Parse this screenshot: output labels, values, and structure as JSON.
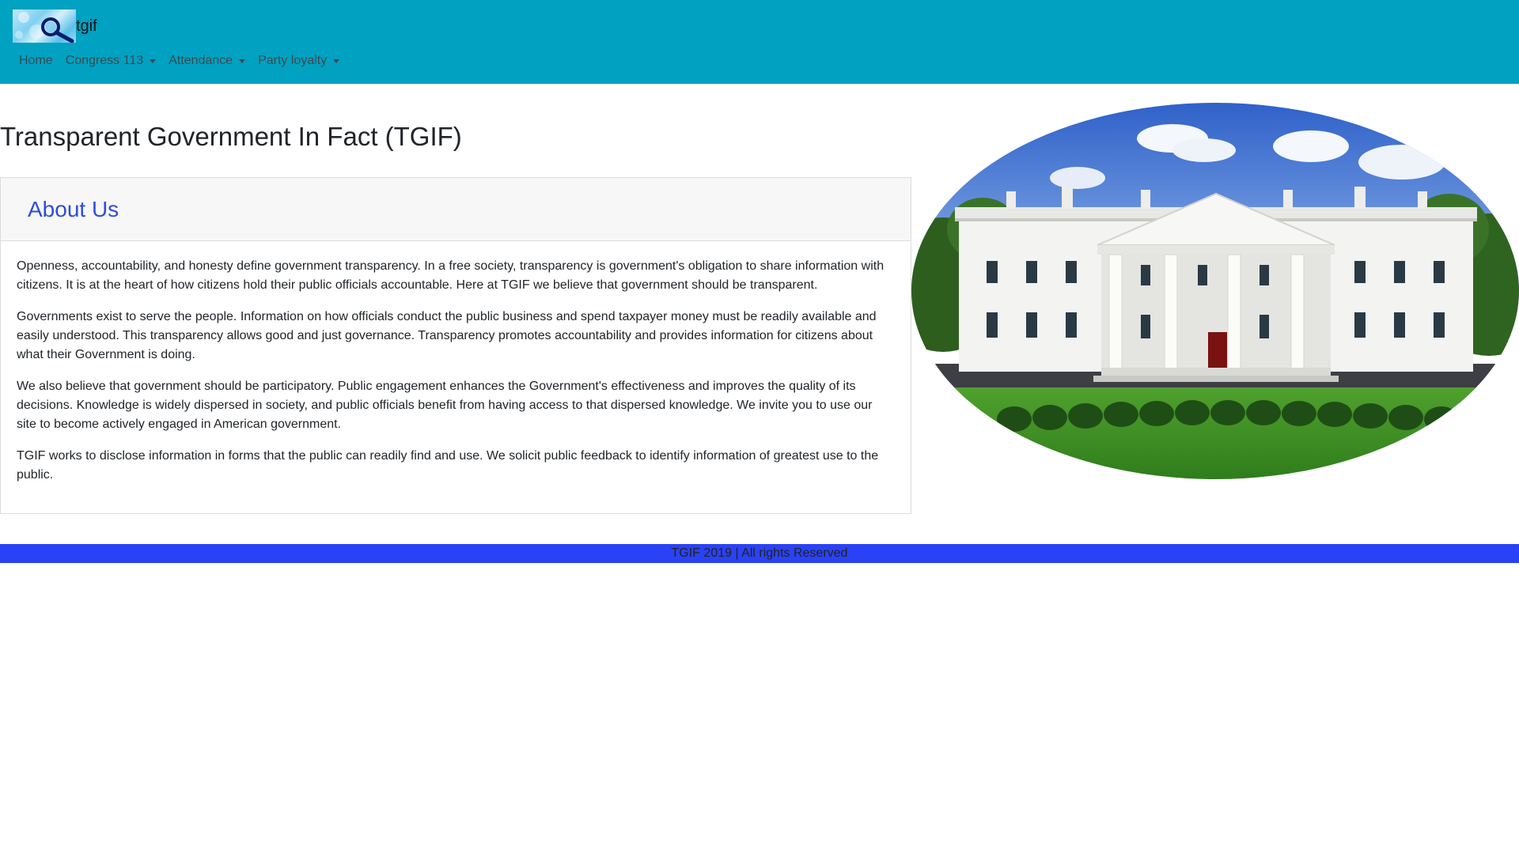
{
  "navbar": {
    "brand_text": "tgif",
    "links": [
      {
        "label": "Home",
        "dropdown": false
      },
      {
        "label": "Congress 113",
        "dropdown": true
      },
      {
        "label": "Attendance",
        "dropdown": true
      },
      {
        "label": "Party loyalty",
        "dropdown": true
      }
    ],
    "background_color": "#00a1c1"
  },
  "main": {
    "title": "Transparent Government In Fact (TGIF)",
    "card": {
      "heading": "About Us",
      "paragraphs": [
        "Openness, accountability, and honesty define government transparency. In a free society, transparency is government's obligation to share information with citizens. It is at the heart of how citizens hold their public officials accountable. Here at TGIF we believe that government should be transparent.",
        "Governments exist to serve the people. Information on how officials conduct the public business and spend taxpayer money must be readily available and easily understood. This transparency allows good and just governance. Transparency promotes accountability and provides information for citizens about what their Government is doing.",
        "We also believe that government should be participatory. Public engagement enhances the Government's effectiveness and improves the quality of its decisions. Knowledge is widely dispersed in society, and public officials benefit from having access to that dispersed knowledge. We invite you to use our site to become actively engaged in American government.",
        "TGIF works to disclose information in forms that the public can readily find and use. We solicit public feedback to identify information of greatest use to the public."
      ]
    },
    "hero_image": "white-house-image"
  },
  "footer": {
    "text": "TGIF 2019 | All rights Reserved",
    "background_color": "#2a42f5"
  }
}
